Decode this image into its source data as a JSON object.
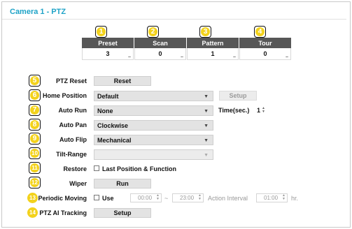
{
  "title": "Camera 1 - PTZ",
  "badges": [
    "1",
    "2",
    "3",
    "4",
    "5",
    "6",
    "7",
    "8",
    "9",
    "10",
    "11",
    "12",
    "13",
    "14"
  ],
  "table": {
    "headers": [
      "Preset",
      "Scan",
      "Pattern",
      "Tour"
    ],
    "values": [
      "3",
      "0",
      "1",
      "0"
    ],
    "more": ".."
  },
  "ptz_reset": {
    "label": "PTZ Reset",
    "button": "Reset"
  },
  "home_position": {
    "label": "Home Position",
    "value": "Default",
    "setup": "Setup"
  },
  "auto_run": {
    "label": "Auto Run",
    "value": "None",
    "time_label": "Time(sec.)",
    "time_value": "1"
  },
  "auto_pan": {
    "label": "Auto Pan",
    "value": "Clockwise"
  },
  "auto_flip": {
    "label": "Auto Flip",
    "value": "Mechanical"
  },
  "tilt_range": {
    "label": "Tilt-Range",
    "value": ""
  },
  "restore": {
    "label": "Restore",
    "option": "Last Position & Function"
  },
  "wiper": {
    "label": "Wiper",
    "button": "Run"
  },
  "periodic_moving": {
    "label": "Periodic Moving",
    "use": "Use",
    "start": "00:00",
    "tilde": "~",
    "end": "23:00",
    "interval_label": "Action Interval",
    "interval": "01:00",
    "unit": "hr."
  },
  "ptz_ai_tracking": {
    "label": "PTZ AI Tracking",
    "button": "Setup"
  },
  "icons": {
    "dropdown": "chevron-down-icon",
    "spinner": "spinner-arrows-icon"
  },
  "colors": {
    "title": "#1fa3c7",
    "badge": "#f3d21c",
    "header": "#575757"
  }
}
